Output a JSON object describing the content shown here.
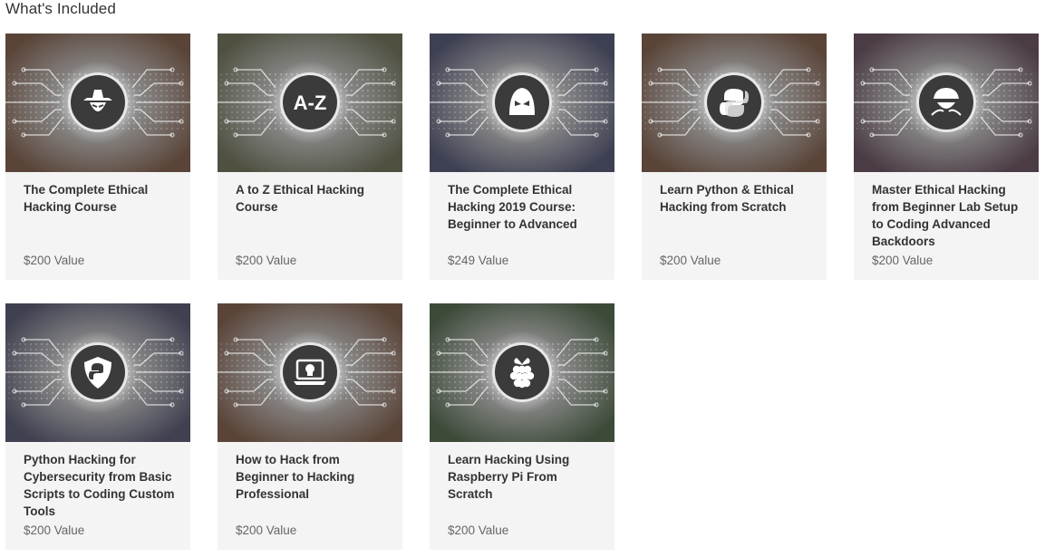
{
  "page": {
    "heading": "What's Included"
  },
  "courses": [
    {
      "title": "The Complete Ethical Hacking Course",
      "price": "$200 Value",
      "icon": "hacker-hat-icon",
      "tint": "#5a4438"
    },
    {
      "title": "A to Z Ethical Hacking Course",
      "price": "$200 Value",
      "icon": "a-z-icon",
      "emblem_text": "A-Z",
      "tint": "#4f5040"
    },
    {
      "title": "The Complete Ethical Hacking 2019 Course: Beginner to Advanced",
      "price": "$249 Value",
      "icon": "hooded-hacker-icon",
      "tint": "#3d3f52"
    },
    {
      "title": "Learn Python & Ethical Hacking from Scratch",
      "price": "$200 Value",
      "icon": "python-logo-icon",
      "tint": "#5a4438"
    },
    {
      "title": "Master Ethical Hacking from Beginner Lab Setup to Coding Advanced Backdoors",
      "price": "$200 Value",
      "icon": "hacker-cap-icon",
      "tint": "#4a3b44"
    },
    {
      "title": "Python Hacking for Cybersecurity from Basic Scripts to Coding Custom Tools",
      "price": "$200 Value",
      "icon": "python-shield-icon",
      "tint": "#3f4050"
    },
    {
      "title": "How to Hack from Beginner to Hacking Professional",
      "price": "$200 Value",
      "icon": "laptop-skull-icon",
      "tint": "#5a4438"
    },
    {
      "title": "Learn Hacking Using Raspberry Pi From Scratch",
      "price": "$200 Value",
      "icon": "raspberry-pi-icon",
      "tint": "#3c4a38"
    }
  ]
}
